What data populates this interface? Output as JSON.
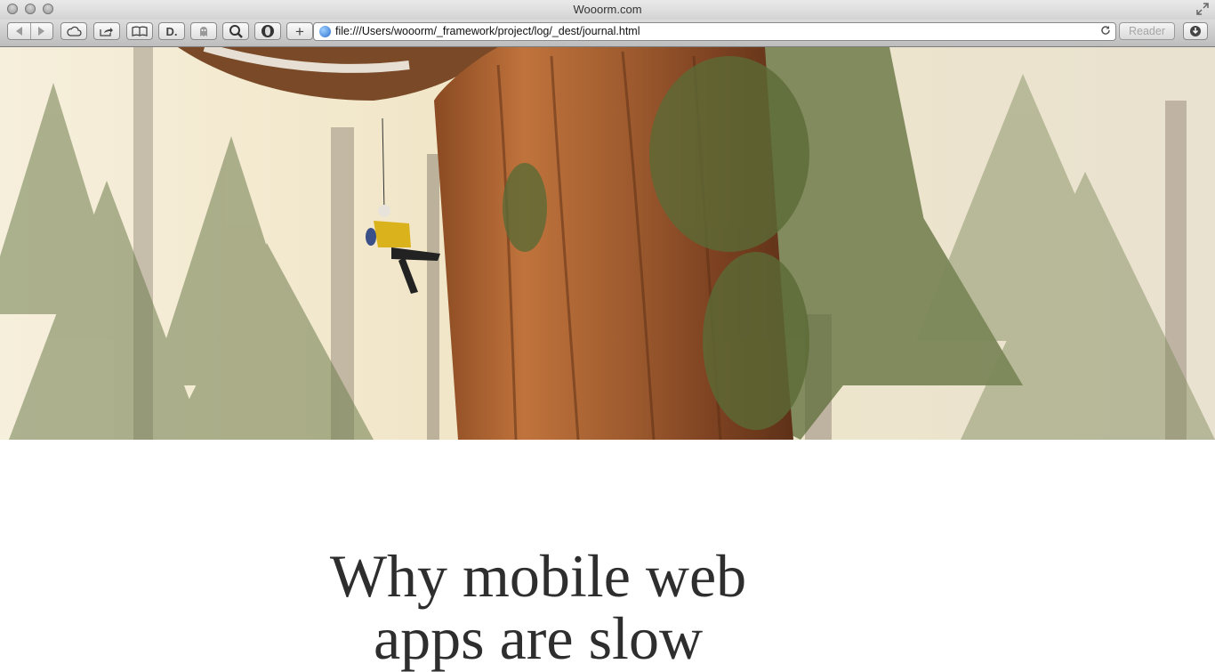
{
  "window": {
    "title": "Wooorm.com"
  },
  "toolbar": {
    "url": "file:///Users/wooorm/_framework/project/log/_dest/journal.html",
    "reader_label": "Reader",
    "new_tab_label": "+"
  },
  "hero": {
    "image_subject": "tree-climber-on-giant-sequoia"
  },
  "article": {
    "headline": "Why mobile web apps are slow"
  }
}
